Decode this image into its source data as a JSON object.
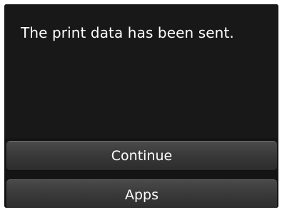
{
  "dialog": {
    "message": "The print data has been sent."
  },
  "buttons": {
    "continue_label": "Continue",
    "apps_label": "Apps"
  },
  "colors": {
    "screen_background": "#141414",
    "text": "#ffffff",
    "button_background": "#3a3a3a"
  }
}
